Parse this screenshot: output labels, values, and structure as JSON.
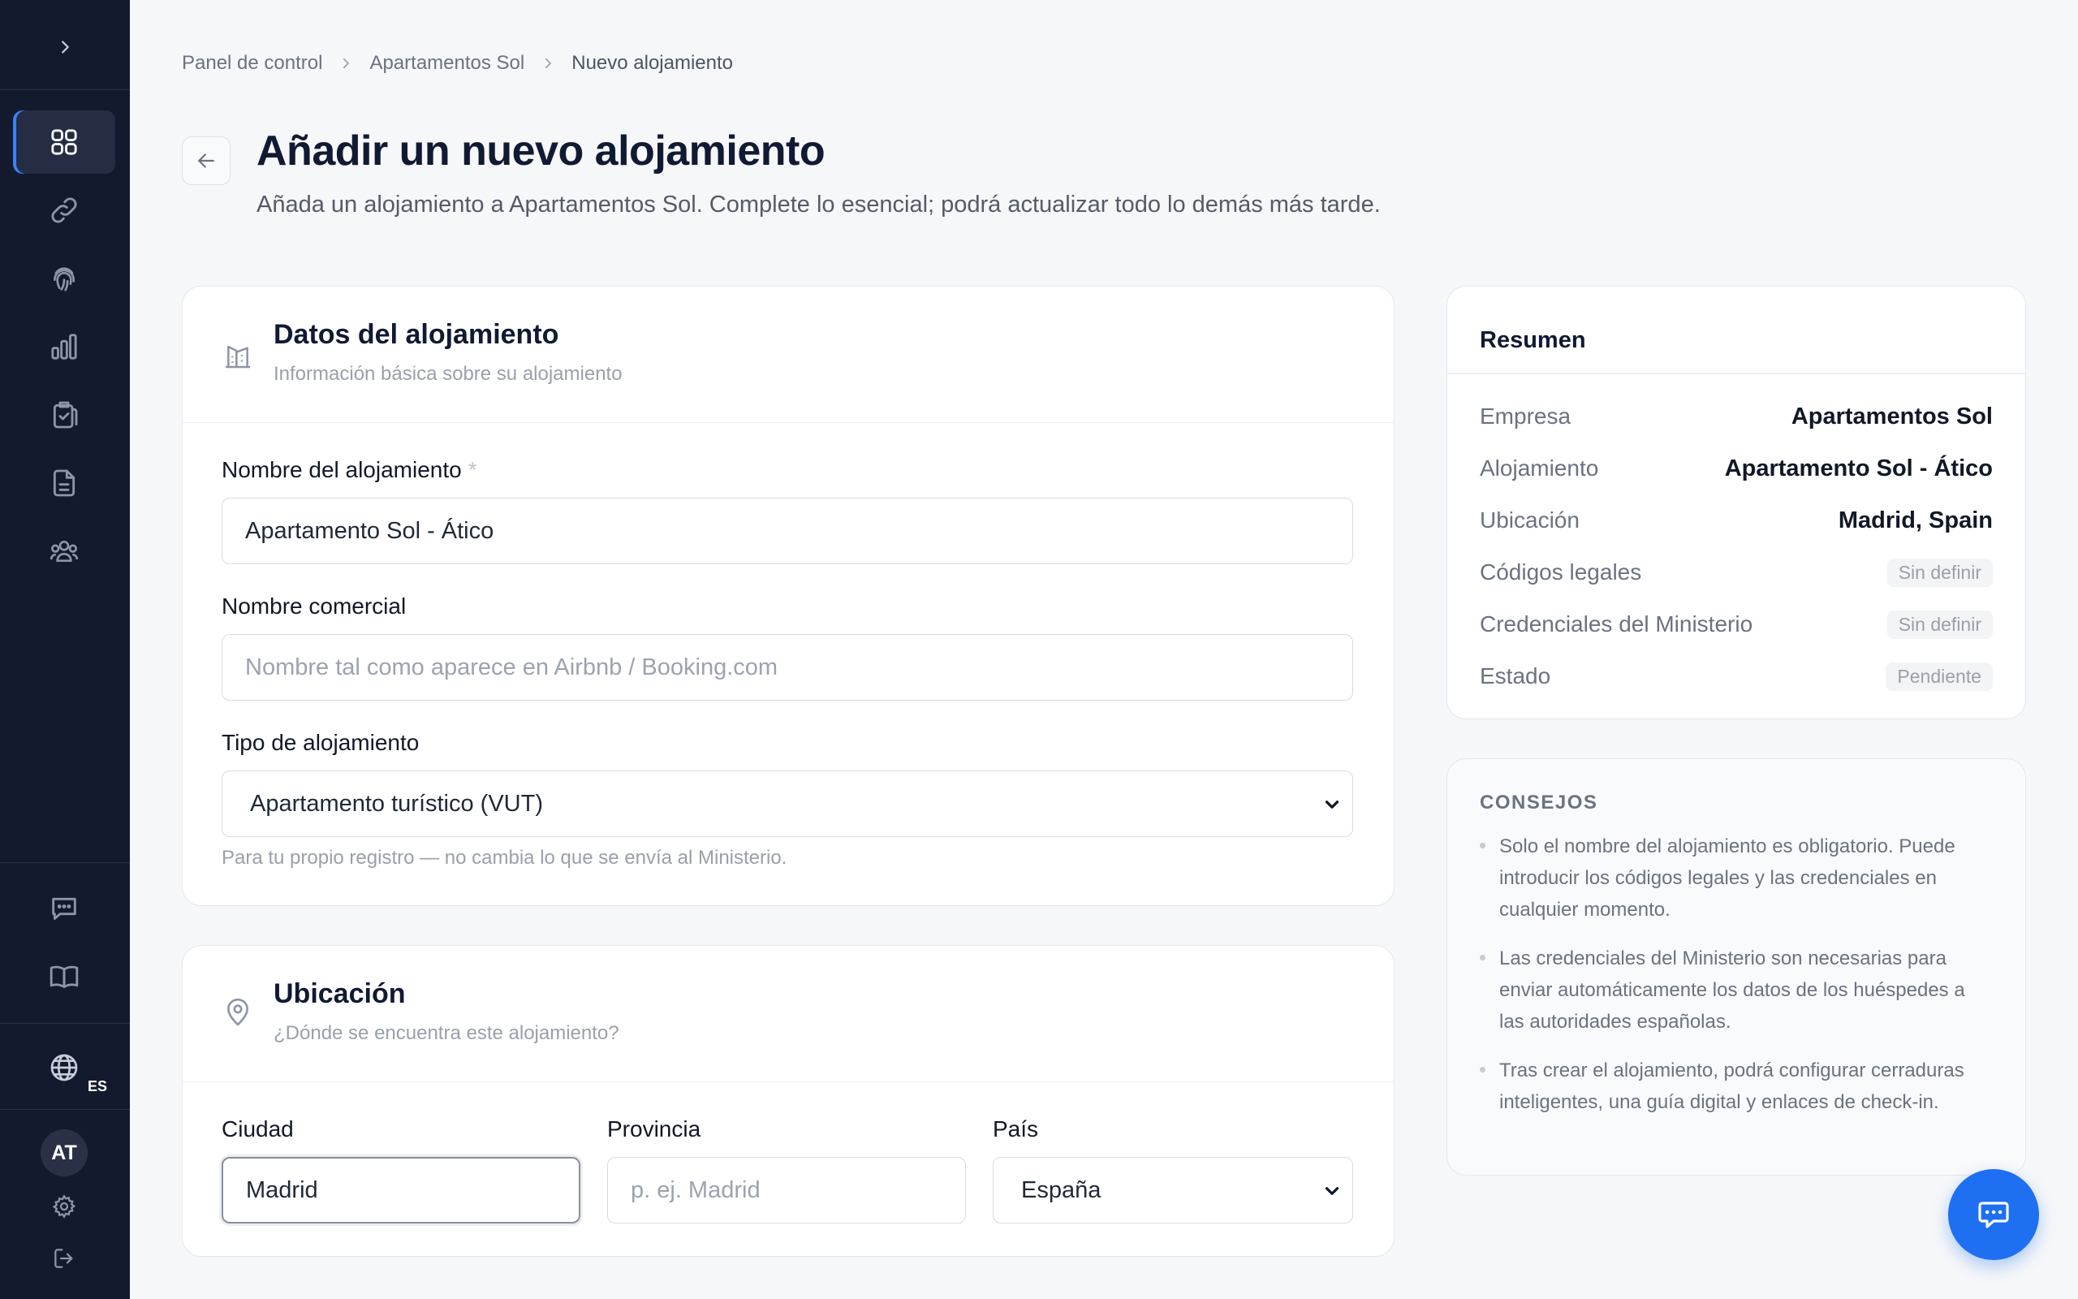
{
  "sidebar": {
    "language": "ES",
    "user_initials": "AT",
    "nav_icons": [
      "grid-icon",
      "link-icon",
      "fingerprint-icon",
      "bar-chart-icon",
      "clipboard-check-icon",
      "document-icon",
      "users-icon"
    ],
    "bottom_icons": [
      "chat-icon",
      "book-icon",
      "globe-icon",
      "gear-icon",
      "logout-icon"
    ]
  },
  "breadcrumb": {
    "items": [
      "Panel de control",
      "Apartamentos Sol",
      "Nuevo alojamiento"
    ]
  },
  "header": {
    "title": "Añadir un nuevo alojamiento",
    "subtitle": "Añada un alojamiento a Apartamentos Sol. Complete lo esencial; podrá actualizar todo lo demás más tarde."
  },
  "details": {
    "title": "Datos del alojamiento",
    "subtitle": "Información básica sobre su alojamiento",
    "name_label": "Nombre del alojamiento",
    "required_mark": "*",
    "name_value": "Apartamento Sol - Ático",
    "commercial_label": "Nombre comercial",
    "commercial_placeholder": "Nombre tal como aparece en Airbnb / Booking.com",
    "type_label": "Tipo de alojamiento",
    "type_value": "Apartamento turístico (VUT)",
    "type_hint": "Para tu propio registro — no cambia lo que se envía al Ministerio."
  },
  "location": {
    "title": "Ubicación",
    "subtitle": "¿Dónde se encuentra este alojamiento?",
    "city_label": "Ciudad",
    "city_value": "Madrid",
    "province_label": "Provincia",
    "province_placeholder": "p. ej. Madrid",
    "country_label": "País",
    "country_value": "España"
  },
  "summary": {
    "title": "Resumen",
    "rows": [
      {
        "key": "Empresa",
        "value": "Apartamentos Sol"
      },
      {
        "key": "Alojamiento",
        "value": "Apartamento Sol - Ático"
      },
      {
        "key": "Ubicación",
        "value": "Madrid, Spain"
      },
      {
        "key": "Códigos legales",
        "value": "Sin definir"
      },
      {
        "key": "Credenciales del Ministerio",
        "value": "Sin definir"
      },
      {
        "key": "Estado",
        "value": "Pendiente"
      }
    ]
  },
  "tips": {
    "title": "CONSEJOS",
    "items": [
      "Solo el nombre del alojamiento es obligatorio. Puede introducir los códigos legales y las credenciales en cualquier momento.",
      "Las credenciales del Ministerio son necesarias para enviar automáticamente los datos de los huéspedes a las autoridades españolas.",
      "Tras crear el alojamiento, podrá configurar cerraduras inteligentes, una guía digital y enlaces de check-in."
    ]
  },
  "colors": {
    "sidebar_bg": "#141a2e",
    "accent": "#1e6ff2",
    "page_bg": "#f6f7f9"
  }
}
